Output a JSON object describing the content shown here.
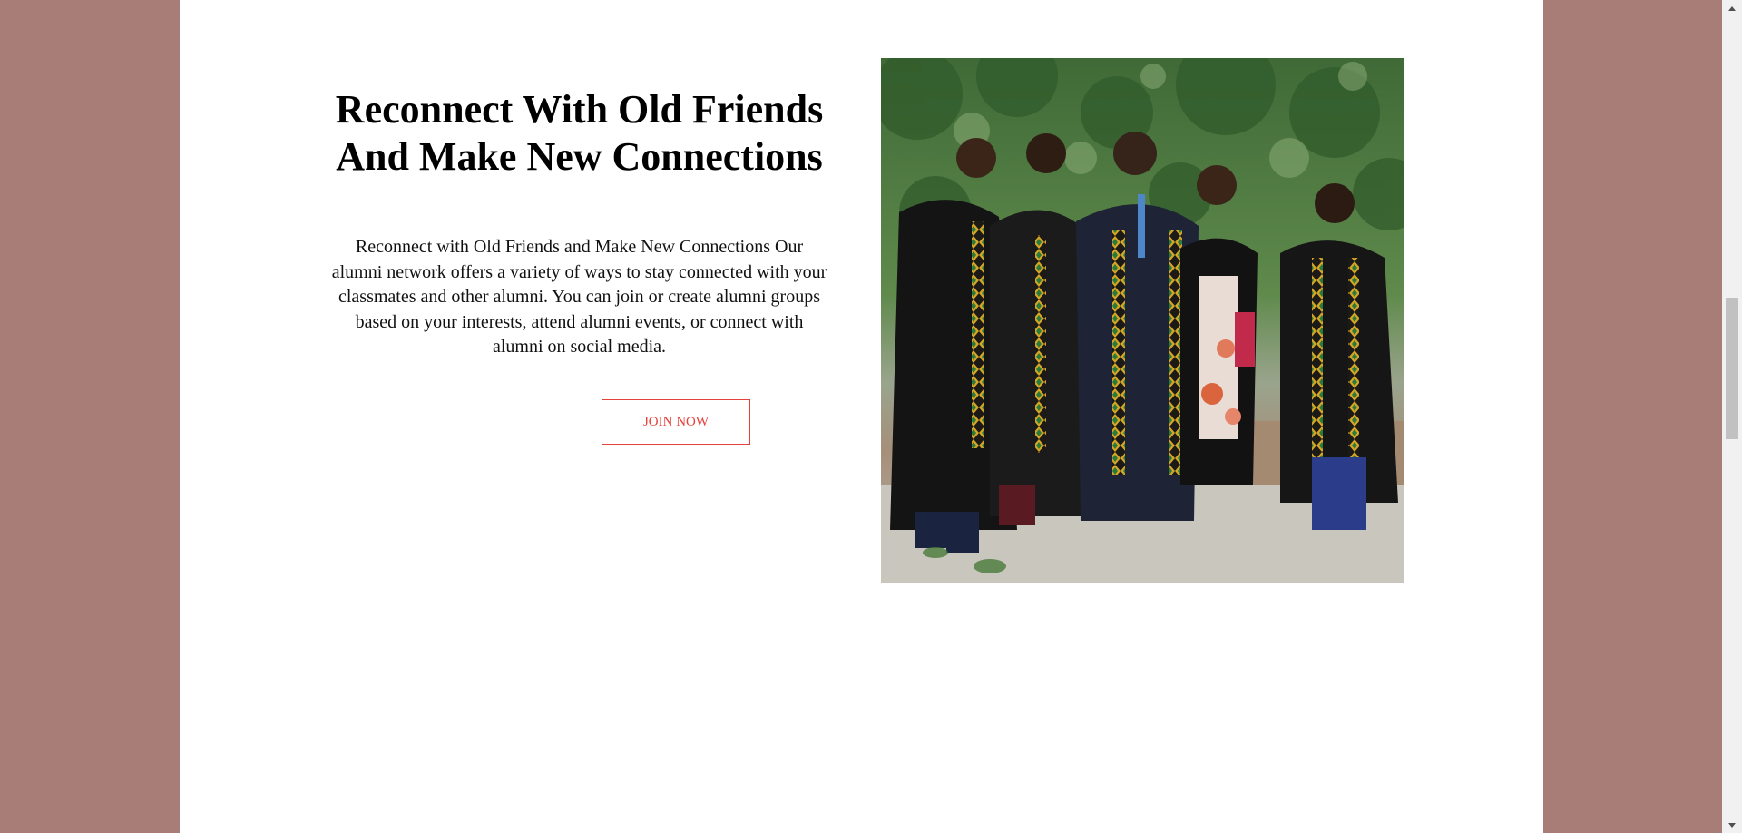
{
  "hero": {
    "headline": "Reconnect With Old Friends And Make New Connections",
    "body": "Reconnect with Old Friends and Make New Connections Our alumni network offers a variety of ways to stay connected with your classmates and other alumni. You can join or create alumni groups based on your interests, attend alumni events, or connect with alumni on social media.",
    "cta_label": "JOIN NOW"
  },
  "photo": {
    "subject": "graduates-in-kente-gowns"
  },
  "colors": {
    "background": "#a97d77",
    "panel": "#ffffff",
    "accent": "#e8413c"
  },
  "scrollbar": {
    "up_icon": "chevron-up-icon",
    "down_icon": "chevron-down-icon"
  }
}
